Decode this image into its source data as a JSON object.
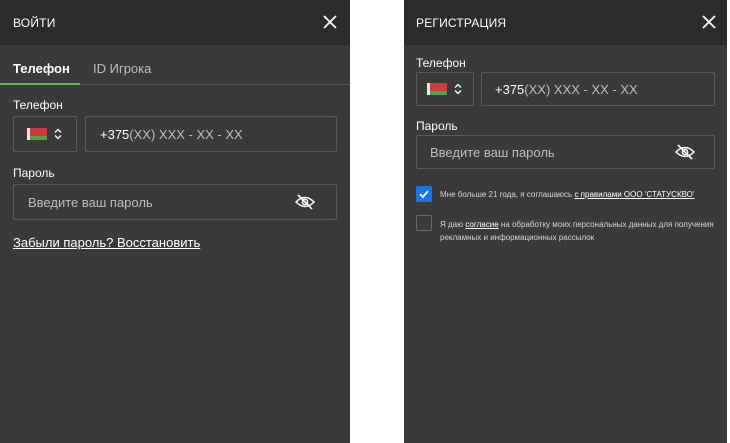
{
  "login": {
    "title": "ВОЙТИ",
    "tabs": [
      {
        "label": "Телефон",
        "active": true
      },
      {
        "label": "ID Игрока",
        "active": false
      }
    ],
    "phone_label": "Телефон",
    "phone_prefix": "+375",
    "phone_mask": "(XX) XXX - XX - XX",
    "password_label": "Пароль",
    "password_placeholder": "Введите ваш пароль",
    "forgot_link": "Забыли пароль? Восстановить",
    "country_flag_icon": "belarus-flag-icon"
  },
  "register": {
    "title": "РЕГИСТРАЦИЯ",
    "phone_label": "Телефон",
    "phone_prefix": "+375",
    "phone_mask": "(XX) XXX - XX - XX",
    "password_label": "Пароль",
    "password_placeholder": "Введите ваш пароль",
    "age_consent": {
      "checked": true,
      "text": "Мне больше 21 года, я соглашаюсь ",
      "link": "с правилами ООО 'СТАТУСКВО'"
    },
    "data_consent": {
      "checked": false,
      "text_before": "Я даю ",
      "link": "согласие",
      "text_after": " на обработку моих персональных данных для получения рекламных и информационных рассылок"
    },
    "country_flag_icon": "belarus-flag-icon"
  },
  "colors": {
    "panel_bg": "#3a3a3a",
    "header_bg": "#2c2c2c",
    "tab_accent": "#5cb85c",
    "checkbox_accent": "#1a73e8"
  }
}
